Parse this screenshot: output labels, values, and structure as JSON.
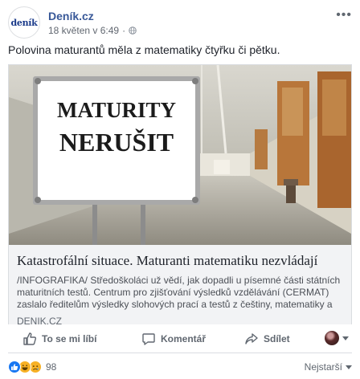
{
  "post": {
    "page_name": "Deník.cz",
    "page_logo_text": "deník",
    "timestamp": "18 květen v 6:49",
    "text": "Polovina maturantů měla z matematiky čtyřku či pětku."
  },
  "link": {
    "sign_line1": "MATURITY",
    "sign_line2": "NERUŠIT",
    "title": "Katastrofální situace. Maturanti matematiku nezvládají",
    "description": "/INFOGRAFIKA/ Středoškoláci už vědí, jak dopadli u písemné části státních maturitních testů. Centrum pro zjišťování výsledků vzdělávání (CERMAT) zaslalo ředitelům výsledky slohových prací a testů z češtiny, matematiky a cizího jazyka v...",
    "domain": "DENIK.CZ"
  },
  "actions": {
    "like_label": "To se mi líbí",
    "comment_label": "Komentář",
    "share_label": "Sdílet"
  },
  "reactions": {
    "count": "98",
    "sort_label": "Nejstarší"
  },
  "colors": {
    "brand_link": "#385898",
    "like_blue": "#1877f2",
    "emoji_yellow": "#f7b125"
  }
}
